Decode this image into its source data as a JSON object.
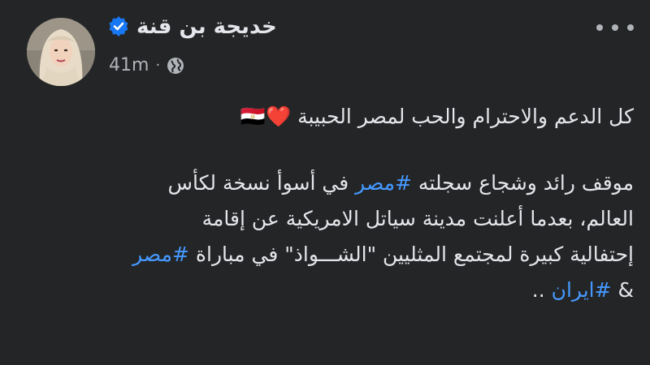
{
  "post": {
    "author_name": "خديجة بن قنة",
    "timestamp": "41m",
    "meta_separator": "·",
    "privacy_icon": "globe-icon",
    "verified_icon": "verified-badge-icon",
    "more_icon": "more-options-icon"
  },
  "content": {
    "line1_text": "كل الدعم والاحترام والحب لمصر الحبيبة",
    "line1_emojis": "❤️🇪🇬",
    "p2_line1_before": "موقف رائد وشجاع سجلته ",
    "p2_line1_hashtag": "#مصر",
    "p2_line1_after": " في أسوأ نسخة لكأس",
    "p2_line2": "العالم، بعدما أعلنت مدينة سياتل الامريكية عن إقامة",
    "p2_line3_text": "إحتفالية كبيرة لمجتمع المثليين \"الشـــواذ\" في مباراة ",
    "p2_line3_hashtag": "#مصر",
    "p2_line4_amp": "& ",
    "p2_line4_hashtag": "#ايران",
    "p2_line4_after": " .."
  },
  "colors": {
    "background": "#242526",
    "text": "#e4e6eb",
    "secondary_text": "#b0b3b8",
    "hashtag": "#4599ff",
    "verified": "#1877f2"
  }
}
